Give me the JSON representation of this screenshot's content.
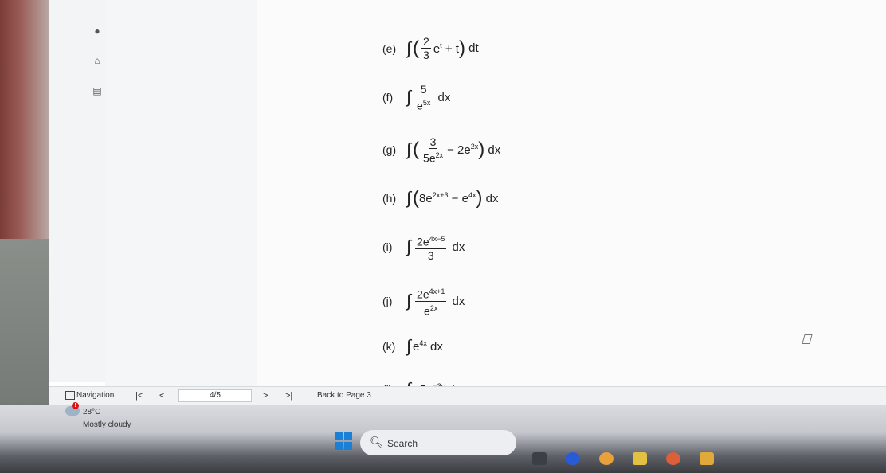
{
  "problems": [
    {
      "label": "(e)"
    },
    {
      "label": "(f)"
    },
    {
      "label": "(g)"
    },
    {
      "label": "(h)"
    },
    {
      "label": "(i)"
    },
    {
      "label": "(j)"
    },
    {
      "label": "(k)"
    },
    {
      "label": "(l)"
    }
  ],
  "navbar": {
    "label": "Navigation",
    "first": "|<",
    "prev": "<",
    "page_value": "4/5",
    "next": ">",
    "last": ">|",
    "back_label": "Back to Page 3"
  },
  "weather": {
    "alert": "!",
    "temp": "28°C",
    "desc": "Mostly cloudy"
  },
  "taskbar": {
    "search_placeholder": "Search"
  },
  "colors": {
    "start_blue": "#1b7fd6",
    "alert_red": "#d11111"
  }
}
